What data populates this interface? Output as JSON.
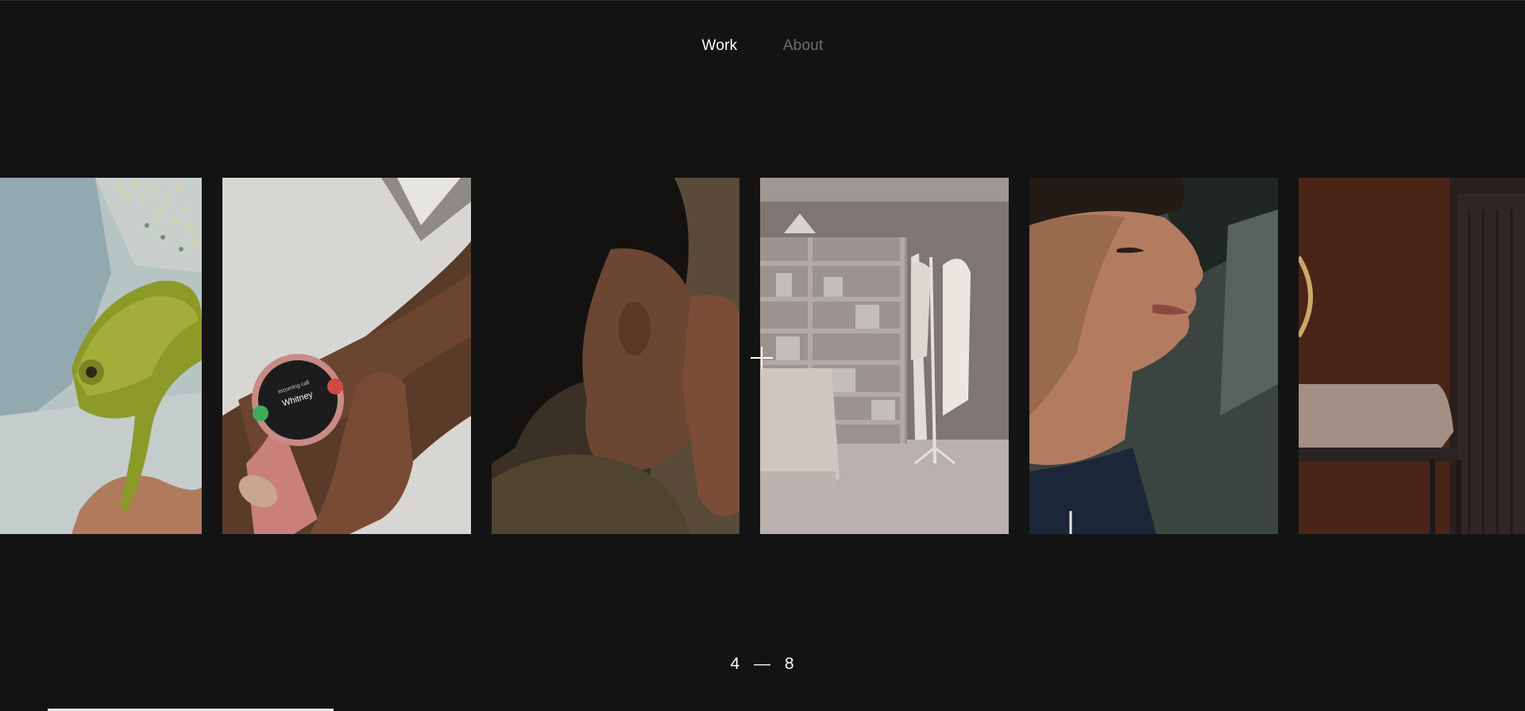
{
  "nav": {
    "items": [
      {
        "label": "Work",
        "active": true
      },
      {
        "label": "About",
        "active": false
      }
    ]
  },
  "gallery": {
    "cards": [
      {
        "name": "chameleon-photo",
        "description": "chameleon on a hand"
      },
      {
        "name": "smartwatch-photo",
        "description": "smartwatch on wrist"
      },
      {
        "name": "hair-portrait-photo",
        "description": "person touching face"
      },
      {
        "name": "room-render-photo",
        "description": "monochrome room"
      },
      {
        "name": "profile-portrait-photo",
        "description": "woman in profile"
      },
      {
        "name": "interior-photo",
        "description": "table and mirror"
      }
    ],
    "watch": {
      "caller_label": "Incoming call",
      "caller_name": "Whitney"
    }
  },
  "counter": {
    "current": "4",
    "separator": "—",
    "total": "8"
  },
  "progress": {
    "fraction": 0.19
  },
  "colors": {
    "background": "#131313",
    "nav_active": "#ffffff",
    "nav_inactive": "#6e6e6e"
  }
}
